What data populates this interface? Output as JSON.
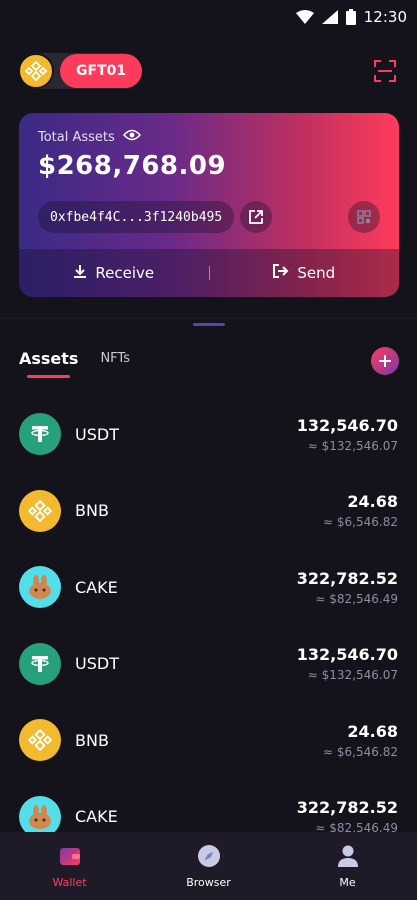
{
  "status_bar": {
    "time": "12:30",
    "icons": [
      "wifi-icon",
      "signal-icon",
      "battery-icon"
    ]
  },
  "header": {
    "wallet_name": "GFT01",
    "wallet_coin_icon": "bnb-coin-icon",
    "scan_icon": "scan-icon"
  },
  "card": {
    "total_label": "Total Assets",
    "total_value": "$268,768.09",
    "address": "0xfbe4f4C...3f1240b495",
    "receive_label": "Receive",
    "send_label": "Send",
    "divider": "|"
  },
  "tabs": {
    "assets_label": "Assets",
    "nfts_label": "NFTs"
  },
  "assets": [
    {
      "symbol": "USDT",
      "amount": "132,546.70",
      "fiat": "≈ $132,546.07",
      "icon": "usdt-icon"
    },
    {
      "symbol": "BNB",
      "amount": "24.68",
      "fiat": "≈ $6,546.82",
      "icon": "bnb-icon"
    },
    {
      "symbol": "CAKE",
      "amount": "322,782.52",
      "fiat": "≈ $82,546.49",
      "icon": "cake-icon"
    },
    {
      "symbol": "USDT",
      "amount": "132,546.70",
      "fiat": "≈ $132,546.07",
      "icon": "usdt-icon"
    },
    {
      "symbol": "BNB",
      "amount": "24.68",
      "fiat": "≈ $6,546.82",
      "icon": "bnb-icon"
    },
    {
      "symbol": "CAKE",
      "amount": "322,782.52",
      "fiat": "≈ $82,546.49",
      "icon": "cake-icon"
    }
  ],
  "bottom_nav": {
    "wallet_label": "Wallet",
    "browser_label": "Browser",
    "me_label": "Me"
  },
  "colors": {
    "background": "#14121b",
    "accent": "#ff3b5c",
    "card_gradient_start": "#3a2a86",
    "card_gradient_end": "#ff3b5c",
    "usdt": "#26a17b",
    "bnb": "#f3ba2f",
    "cake": "#53dee9",
    "nav_background": "#1e1a27"
  }
}
